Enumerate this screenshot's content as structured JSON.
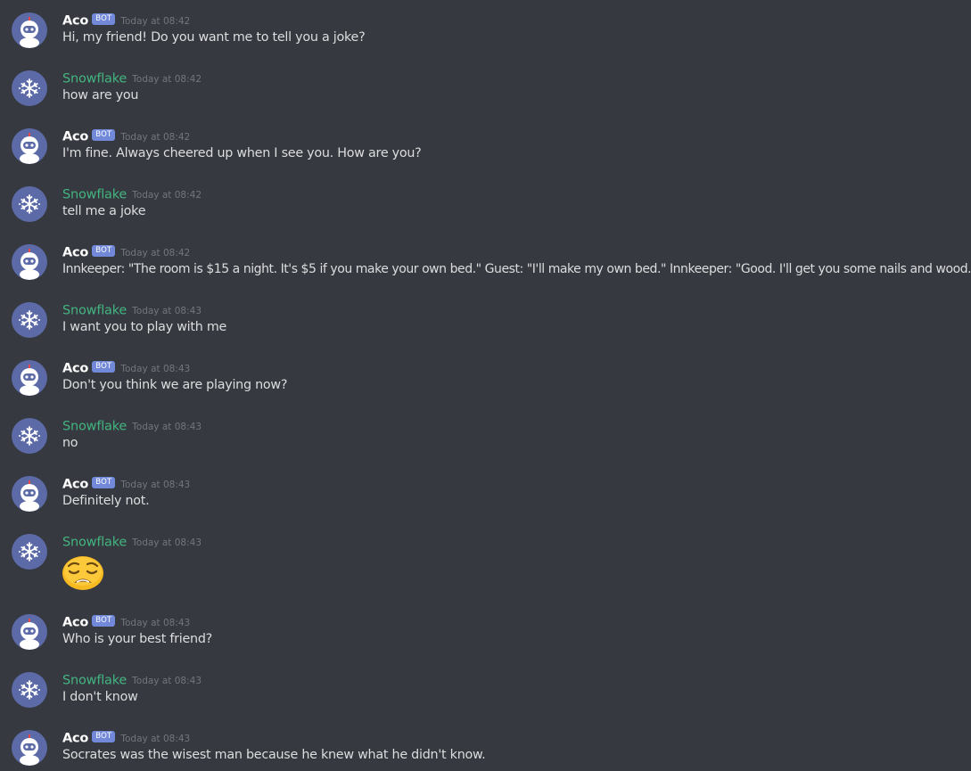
{
  "channel": {
    "messages": [
      {
        "author": "Aco",
        "badge": "BOT",
        "time": "Today at 08:42",
        "text": "Hi, my friend! Do you want me to tell you a joke?",
        "avatar": "robot-icon"
      },
      {
        "author": "Snowflake",
        "badge": "",
        "time": "Today at 08:42",
        "text": "how are you",
        "avatar": "snowflake-icon"
      },
      {
        "author": "Aco",
        "badge": "BOT",
        "time": "Today at 08:42",
        "text": "I'm fine. Always cheered up when I see you. How are you?",
        "avatar": "robot-icon"
      },
      {
        "author": "Snowflake",
        "badge": "",
        "time": "Today at 08:42",
        "text": "tell me a joke",
        "avatar": "snowflake-icon"
      },
      {
        "author": "Aco",
        "badge": "BOT",
        "time": "Today at 08:42",
        "text": "Innkeeper: \"The room is $15 a night. It's $5 if you make your own bed.\" Guest: \"I'll make my own bed.\" Innkeeper: \"Good. I'll get you some nails and wood.\"",
        "avatar": "robot-icon"
      },
      {
        "author": "Snowflake",
        "badge": "",
        "time": "Today at 08:43",
        "text": "I want you to play with me",
        "avatar": "snowflake-icon"
      },
      {
        "author": "Aco",
        "badge": "BOT",
        "time": "Today at 08:43",
        "text": "Don't you think we are playing now?",
        "avatar": "robot-icon"
      },
      {
        "author": "Snowflake",
        "badge": "",
        "time": "Today at 08:43",
        "text": "no",
        "avatar": "snowflake-icon"
      },
      {
        "author": "Aco",
        "badge": "BOT",
        "time": "Today at 08:43",
        "text": "Definitely not.",
        "avatar": "robot-icon"
      },
      {
        "author": "Snowflake",
        "badge": "",
        "time": "Today at 08:43",
        "text": "",
        "emoji": "weary-face-emoji",
        "avatar": "snowflake-icon"
      },
      {
        "author": "Aco",
        "badge": "BOT",
        "time": "Today at 08:43",
        "text": "Who is your best friend?",
        "avatar": "robot-icon"
      },
      {
        "author": "Snowflake",
        "badge": "",
        "time": "Today at 08:43",
        "text": "I don't know",
        "avatar": "snowflake-icon"
      },
      {
        "author": "Aco",
        "badge": "BOT",
        "time": "Today at 08:43",
        "text": "Socrates was the wisest man because he knew what he didn't know.",
        "avatar": "robot-icon"
      }
    ]
  },
  "colors": {
    "background": "#36393f",
    "bot_name": "#ffffff",
    "user_name": "#43b581",
    "badge": "#7289da",
    "timestamp": "#72767d",
    "message_text": "#dcddde",
    "avatar_bg": "#5c6aa7"
  }
}
